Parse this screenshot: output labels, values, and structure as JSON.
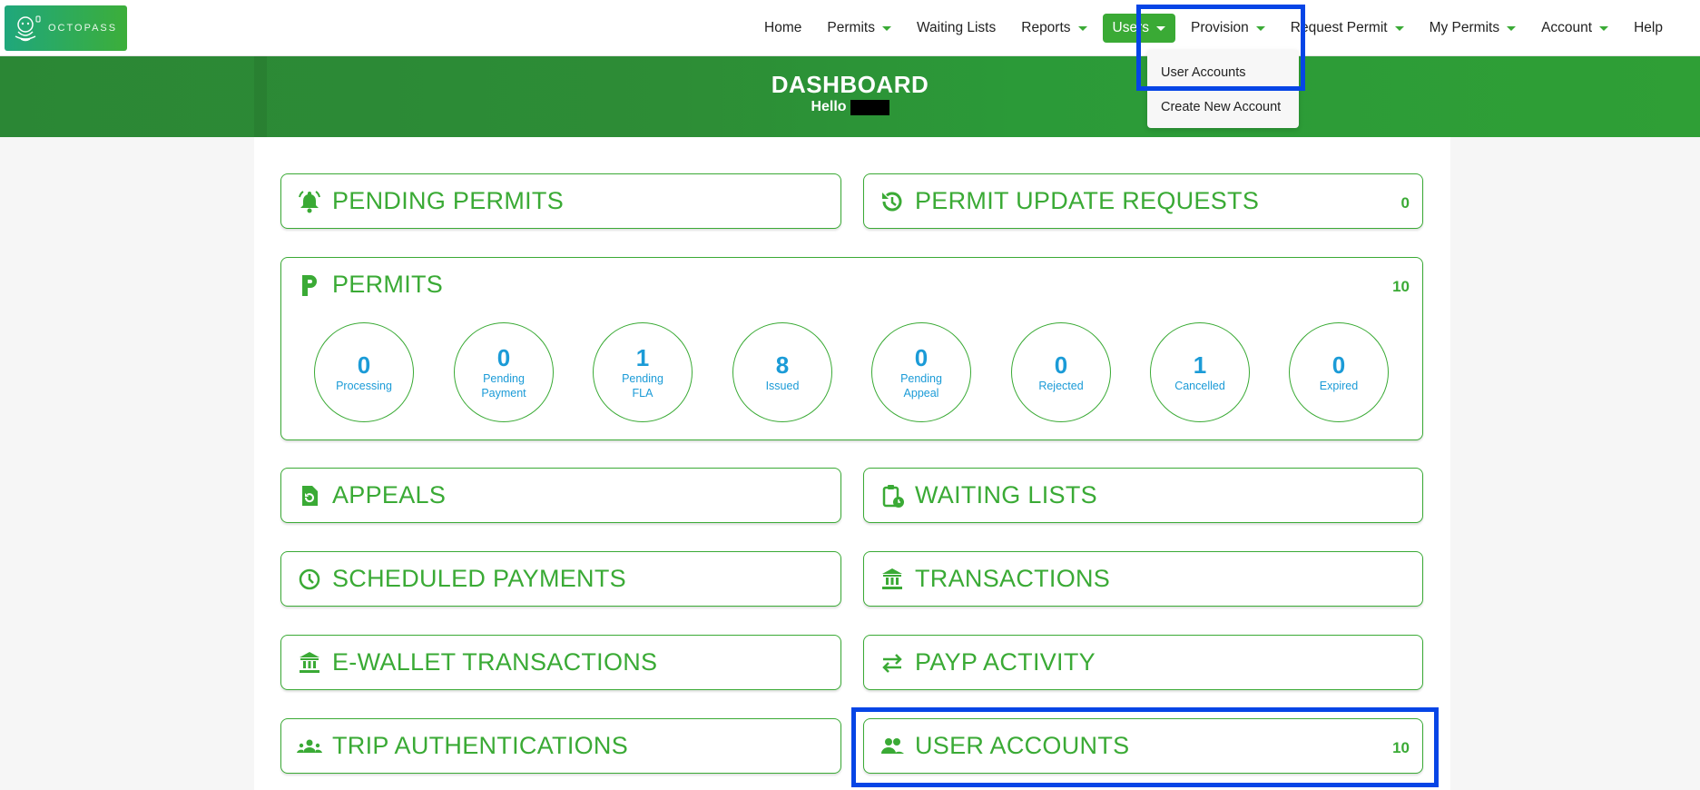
{
  "brand": {
    "logo_text": "OCTOPASS"
  },
  "nav": {
    "items": [
      {
        "label": "Home"
      },
      {
        "label": "Permits"
      },
      {
        "label": "Waiting Lists"
      },
      {
        "label": "Reports"
      },
      {
        "label": "Users"
      },
      {
        "label": "Provision"
      },
      {
        "label": "Request Permit"
      },
      {
        "label": "My Permits"
      },
      {
        "label": "Account"
      },
      {
        "label": "Help"
      }
    ],
    "users_dropdown": [
      "User Accounts",
      "Create New Account"
    ]
  },
  "banner": {
    "title": "DASHBOARD",
    "greeting": "Hello"
  },
  "cards": {
    "pending_permits": {
      "title": "PENDING PERMITS"
    },
    "permit_update_requests": {
      "title": "PERMIT UPDATE REQUESTS",
      "count": "0"
    },
    "permits": {
      "title": "PERMITS",
      "count": "10",
      "stats": [
        {
          "value": "0",
          "label": "Processing"
        },
        {
          "value": "0",
          "label": "Pending Payment"
        },
        {
          "value": "1",
          "label": "Pending FLA"
        },
        {
          "value": "8",
          "label": "Issued"
        },
        {
          "value": "0",
          "label": "Pending Appeal"
        },
        {
          "value": "0",
          "label": "Rejected"
        },
        {
          "value": "1",
          "label": "Cancelled"
        },
        {
          "value": "0",
          "label": "Expired"
        }
      ]
    },
    "appeals": {
      "title": "APPEALS"
    },
    "waiting_lists": {
      "title": "WAITING LISTS"
    },
    "scheduled_payments": {
      "title": "SCHEDULED PAYMENTS"
    },
    "transactions": {
      "title": "TRANSACTIONS"
    },
    "ewallet": {
      "title": "E-WALLET TRANSACTIONS"
    },
    "payp": {
      "title": "PAYP ACTIVITY"
    },
    "trip_auth": {
      "title": "TRIP AUTHENTICATIONS"
    },
    "user_accounts": {
      "title": "USER ACCOUNTS",
      "count": "10"
    }
  },
  "colors": {
    "brand_green": "#3aaa35",
    "stat_blue": "#1b9bd7",
    "highlight": "#0645e6"
  }
}
